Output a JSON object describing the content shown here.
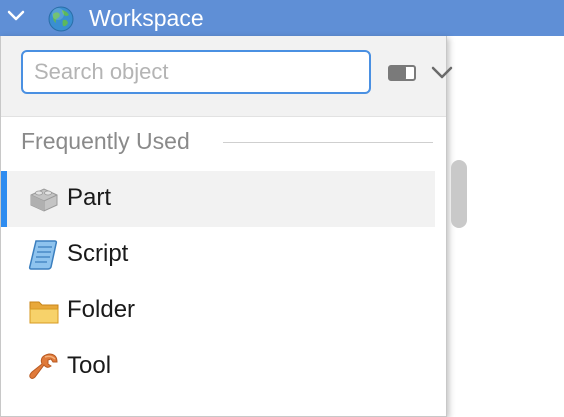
{
  "explorer": {
    "title": "Workspace",
    "icons": {
      "expand": "chevron-down-icon",
      "workspace": "globe-icon"
    }
  },
  "insert_popup": {
    "search": {
      "placeholder": "Search object",
      "value": ""
    },
    "section_title": "Frequently Used",
    "items": [
      {
        "label": "Part",
        "icon": "part-brick-icon",
        "selected": true
      },
      {
        "label": "Script",
        "icon": "script-scroll-icon",
        "selected": false
      },
      {
        "label": "Folder",
        "icon": "folder-icon",
        "selected": false
      },
      {
        "label": "Tool",
        "icon": "wrench-icon",
        "selected": false
      }
    ],
    "colors": {
      "accent": "#2e8cf0",
      "topbar": "#5f8fd6",
      "search_border": "#4a90e2"
    }
  }
}
